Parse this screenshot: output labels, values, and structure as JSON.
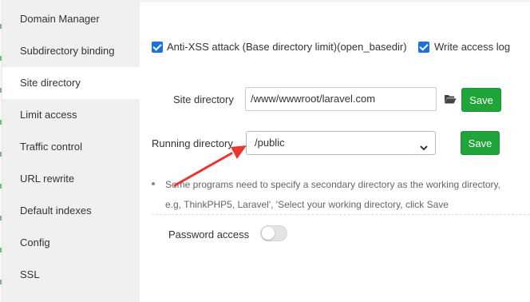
{
  "sidebar": {
    "items": [
      {
        "label": "Domain Manager"
      },
      {
        "label": "Subdirectory binding"
      },
      {
        "label": "Site directory"
      },
      {
        "label": "Limit access"
      },
      {
        "label": "Traffic control"
      },
      {
        "label": "URL rewrite"
      },
      {
        "label": "Default indexes"
      },
      {
        "label": "Config"
      },
      {
        "label": "SSL"
      }
    ],
    "active_index": 2
  },
  "options": {
    "anti_xss_label": "Anti-XSS attack (Base directory limit)(open_basedir)",
    "anti_xss_checked": true,
    "write_log_label": "Write access log",
    "write_log_checked": true
  },
  "site_directory": {
    "label": "Site directory",
    "value": "/www/wwwroot/laravel.com",
    "folder_icon": "folder-open-icon",
    "save_label": "Save"
  },
  "running_directory": {
    "label": "Running directory",
    "selected": "/public",
    "save_label": "Save"
  },
  "note": {
    "line1": "Some programs need to specify a secondary directory as the working directory,",
    "line2": "e.g, ThinkPHP5, Laravel', 'Select your working directory, click Save"
  },
  "password_access": {
    "label": "Password access",
    "enabled": false
  },
  "colors": {
    "accent_green": "#20a53a",
    "checkbox_blue": "#1c72d8",
    "annotation_red": "#e8382e"
  }
}
